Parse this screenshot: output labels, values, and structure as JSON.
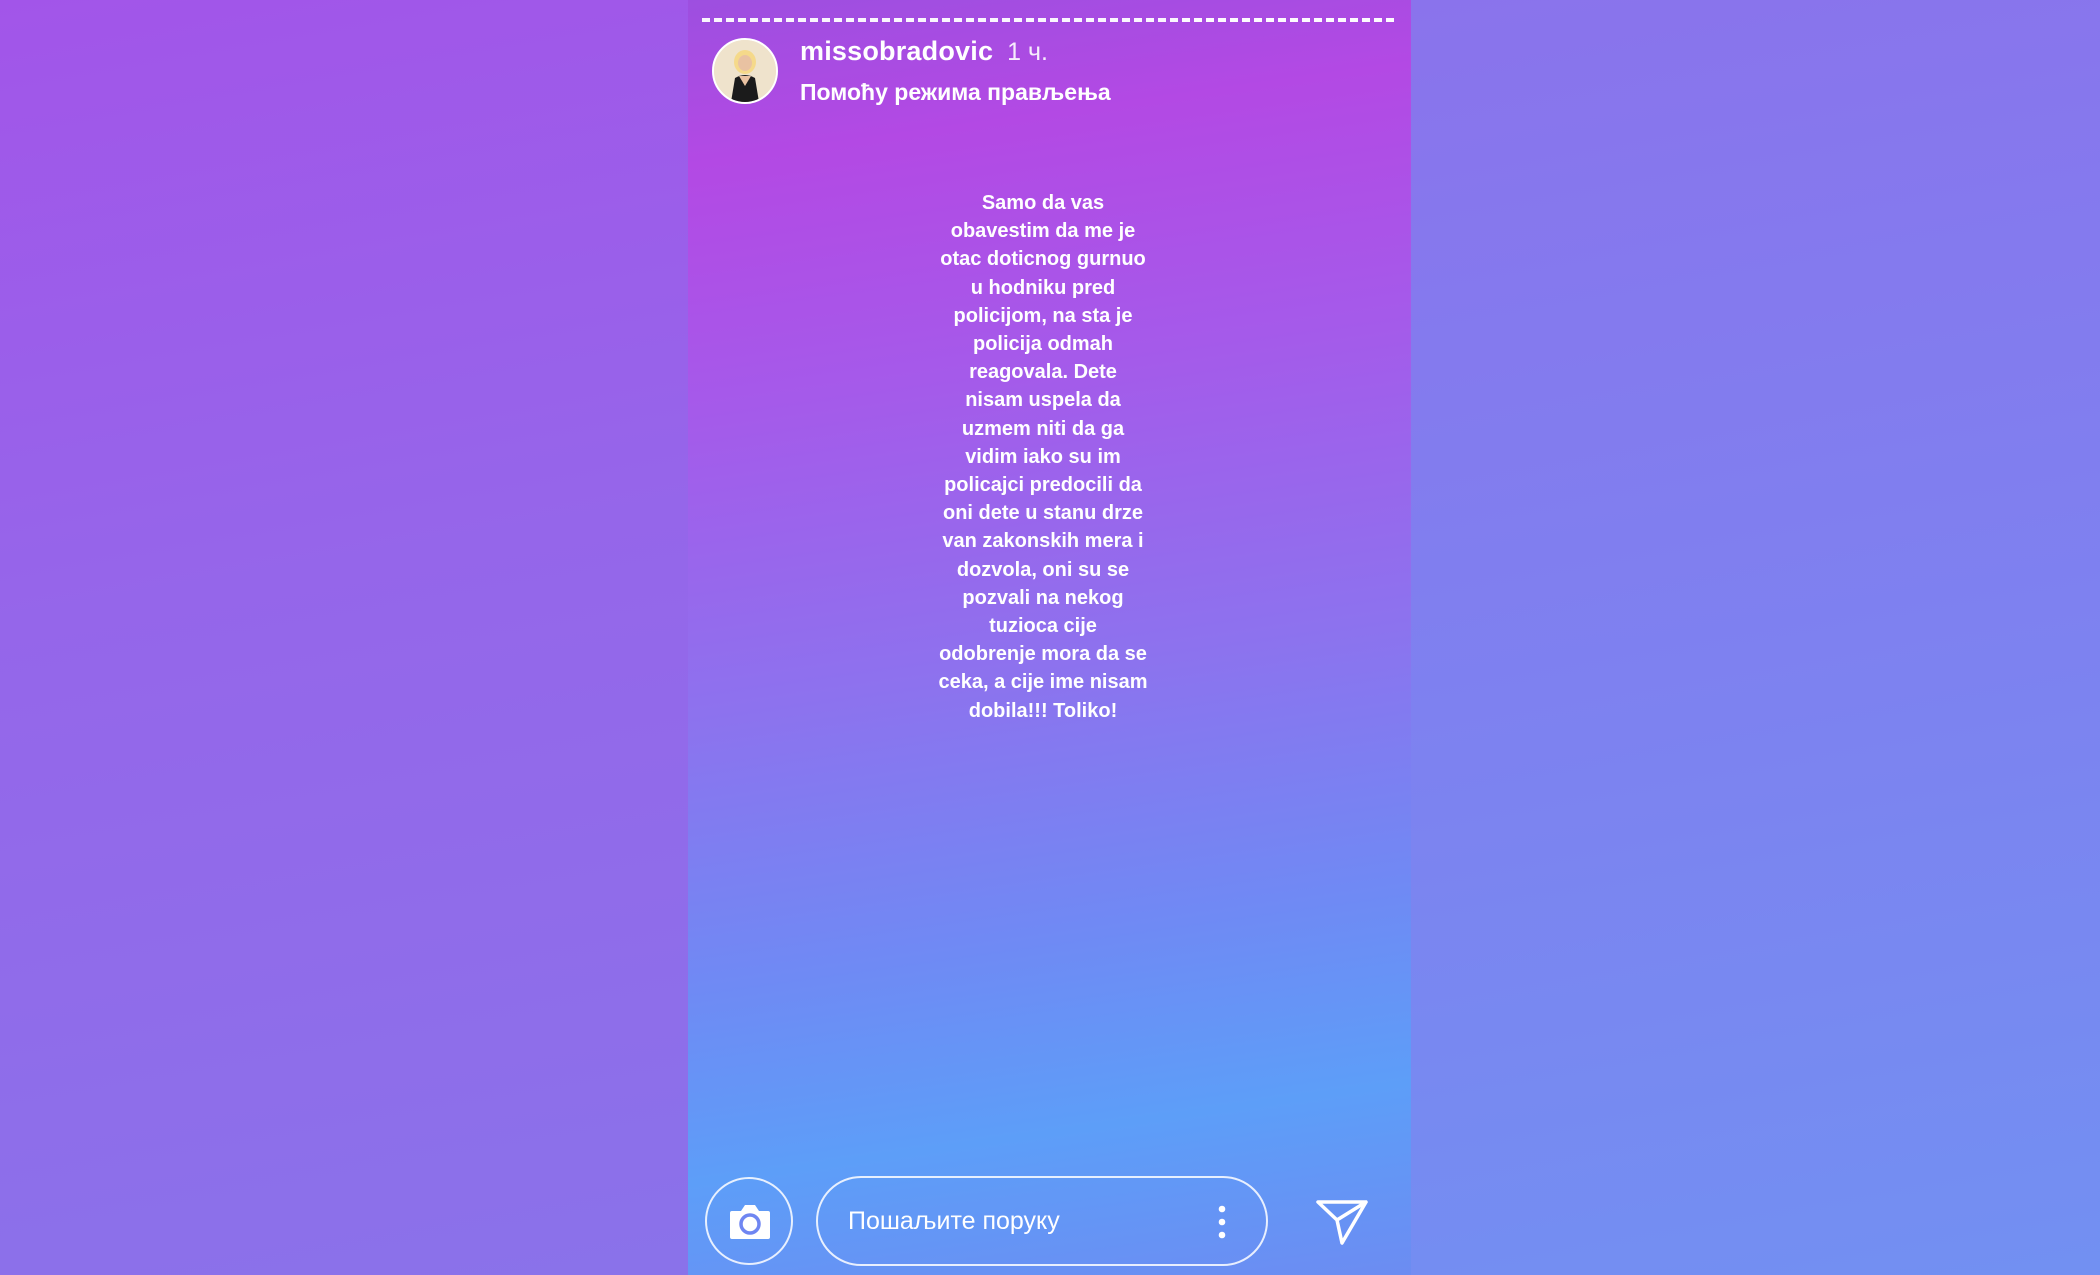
{
  "story": {
    "username": "missobradovic",
    "time": "1 ч.",
    "subtitle": "Помоћу режима прављења",
    "text": "Samo da vas\nobavestim da me je\notac doticnog gurnuo\nu hodniku pred\npolicijom, na sta je\npolicija odmah\nreagovala. Dete\nnisam uspela da\nuzmem niti da ga\nvidim iako su im\npolicajci predocili da\noni dete u stanu drze\nvan zakonskih mera i\ndozvola, oni su se\npozvali na nekog\ntuzioca cije\nodobrenje mora da se\nceka, a cije ime nisam\ndobila!!! Toliko!"
  },
  "footer": {
    "message_placeholder": "Пошаљите поруку"
  },
  "icons": {
    "camera": "camera-icon",
    "more": "more-vertical-icon",
    "send": "send-icon"
  }
}
